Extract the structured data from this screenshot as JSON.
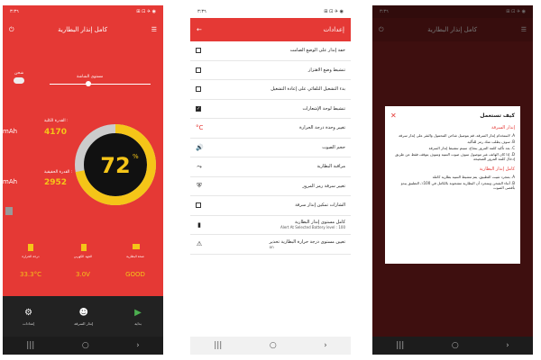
{
  "status_time": "٣:٣٦",
  "status_left_icons": "⊡ ▣ ◢ ▮",
  "status_right_icons": "⊞ ⊡ ✈ ◉",
  "screen1": {
    "title": "كامل إنذار البطارية",
    "slider_label": "مستوى الشاشة",
    "slider_side_label": "شحن",
    "capacity_label": "القدرة الكلية :",
    "capacity_value": "4170",
    "capacity_unit": "mAh",
    "actual_label": "القدرة الحقيقية :",
    "actual_value": "2952",
    "actual_unit": "mAh",
    "gauge_value": "72",
    "gauge_unit": "%",
    "gauge_level_percent": 72,
    "temp_label": "درجة الحرارة",
    "temp_value": "33.3°C",
    "voltage_label": "الجهد الكهربي",
    "voltage_value": "3.0V",
    "health_label": "صحة البطارية",
    "health_value": "GOOD",
    "nav": [
      {
        "label": "إعدادات",
        "icon": "gear-icon"
      },
      {
        "label": "إنذار السرقة",
        "icon": "thief-icon"
      },
      {
        "label": "بداية",
        "icon": "play-icon"
      }
    ]
  },
  "screen2": {
    "title": "إعدادات",
    "rows": [
      {
        "text": "خفة إنذار على الوضع الصامت",
        "ctrl": "checkbox",
        "checked": false
      },
      {
        "text": "تنشيط وضع الاهتزاز",
        "ctrl": "checkbox",
        "checked": false
      },
      {
        "text": "بدء التشغيل التلقائي على إعادة التشغيل",
        "ctrl": "checkbox",
        "checked": false
      },
      {
        "text": "تنشيط لوحة الإشعارات",
        "ctrl": "checkbox",
        "checked": true
      },
      {
        "text": "تغيير وحدة درجة الحرارة",
        "ctrl": "icon",
        "icon": "°C"
      },
      {
        "text": "حجم الصوت",
        "ctrl": "icon",
        "icon": "🔊"
      },
      {
        "text": "مراقبة البطارية",
        "ctrl": "icon",
        "icon": "⤳"
      },
      {
        "text": "تغيير سرقة رمز المرور",
        "ctrl": "icon",
        "icon": "⛨"
      },
      {
        "text": "الشارات تمكين إنذار سرقة",
        "ctrl": "checkbox",
        "checked": false
      },
      {
        "text": "كامل مستوى إنذار البطارية",
        "sub": "Alert At Selected Battery level : 100",
        "ctrl": "icon",
        "icon": "▮"
      },
      {
        "text": "تعيين مستوى درجة حرارة البطارية تحذير",
        "sub": "on",
        "ctrl": "icon",
        "icon": "⚠"
      }
    ]
  },
  "screen3": {
    "dialog_title": "كيف تستعمل",
    "section1": "إنذار السرقة",
    "items1": [
      "A. لاستخدام إنذار السرقة، قم بتوصيل شاحن المحمول والنقر على إنذار سرقة",
      "B. سوف يطلب منك رمز للتأكيد",
      "C. بعد تأكيد كلمة المرور بنجاح، سيتم تنشيط إنذار السرقة",
      "D. إذا كان الهاتف غير موصول سوف صوت التنبيه وسوف يتوقف فقط عن طريق إدخال كلمة المرور الصحيحة"
    ],
    "section2": "كامل إنذار البطارية",
    "items2": [
      "A. بمجرد تثبيت التطبيق، يتم تنشيط التنبيه بطارية كاملة",
      "B. أثناء الشحن وبمجرد أن البطارية مشحونة بالكامل في 100٪، التطبيق يبدو بأقصى الصوت"
    ]
  }
}
